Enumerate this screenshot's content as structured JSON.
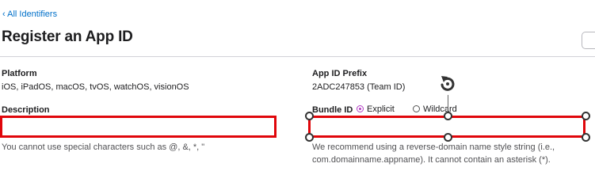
{
  "nav": {
    "back_link": "‹ All Identifiers"
  },
  "header": {
    "title": "Register an App ID"
  },
  "platform": {
    "label": "Platform",
    "value": "iOS, iPadOS, macOS, tvOS, watchOS, visionOS"
  },
  "prefix": {
    "label": "App ID Prefix",
    "value": "2ADC247853 (Team ID)"
  },
  "description": {
    "label": "Description",
    "value": "",
    "placeholder": "",
    "hint": "You cannot use special characters such as @, &, *, \""
  },
  "bundle": {
    "label": "Bundle ID",
    "options": [
      {
        "label": "Explicit",
        "selected": true
      },
      {
        "label": "Wildcard",
        "selected": false
      }
    ],
    "value": "",
    "hint": "We recommend using a reverse-domain name style string (i.e., com.domainname.appname). It cannot contain an asterisk (*)."
  },
  "colors": {
    "accent_link": "#0070c9",
    "highlight_red": "#e0060b",
    "radio_purple": "#b23ec4"
  },
  "icons": {
    "rotate_handle": "rotate-icon",
    "resize_handle": "resize-handle"
  }
}
